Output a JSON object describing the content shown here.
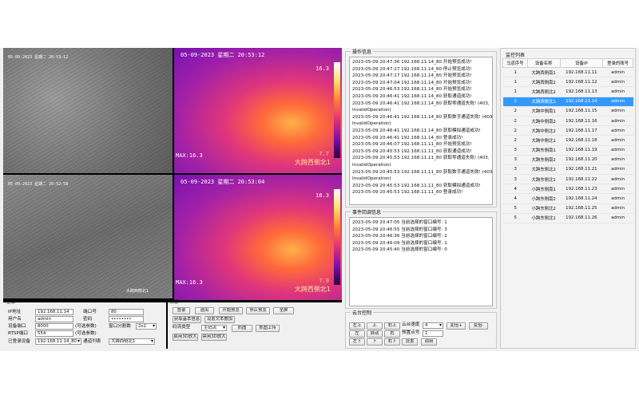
{
  "video": {
    "cam1_stamp": "05-09-2023 星期二 20:53:12",
    "cam2_stamp": "05-09-2023 星期二 20:52:58",
    "cam2_name": "大跨西侧北1",
    "thermal1": {
      "stamp": "05-09-2023 星期二 20:53:12",
      "top_val": "16.3",
      "max_label": "MAX:16.3",
      "min_val": "7.7",
      "name": "大跨西侧北1"
    },
    "thermal2": {
      "stamp": "05-09-2023 星期二 20:53:04",
      "top_val": "16.3",
      "max_label": "MAX:16.3",
      "min_val": "7.9",
      "name": "大跨西侧北1"
    }
  },
  "operation": {
    "title": "操作信息",
    "logs": [
      "2023-05-09 20:47:36 192.168.11.14_80 开始预览成功!",
      "2023-05-09 20:47:27 192.168.11.14_80 停止预览成功!",
      "2023-05-09 20:47:17 192.168.11.14_80 开始预览成功!",
      "2023-05-09 20:47:04 192.168.11.14_80 开始预览成功!",
      "2023-05-09 20:46:53 192.168.11.14_80 开始预览成功!",
      "2023-05-09 20:46:41 192.168.11.14_80 获取通道成功!",
      "2023-05-09 20:46:41 192.168.11.14_80 获取零通道失败! (403,",
      "InvalidOperation)",
      "2023-05-09 20:46:41 192.168.11.14_80 获取数字通道失败! (403,",
      "InvalidOperation)",
      "2023-05-09 20:46:41 192.168.11.14_80 获取模拟通道成功!",
      "2023-05-09 20:46:41 192.168.11.14_80 登录成功!",
      "2023-05-09 20:46:07 192.168.11.11_80 开始预览成功!",
      "2023-05-09 20:45:53 192.168.11.11_80 获取通道成功!",
      "2023-05-09 20:45:53 192.168.11.11_80 获取零通道失败! (403,",
      "InvalidOperation)",
      "2023-05-09 20:45:53 192.168.11.11_80 获取数字通道失败! (403,",
      "InvalidOperation)",
      "2023-05-09 20:45:53 192.168.11.11_80 获取模拟通道成功!",
      "2023-05-09 20:45:53 192.168.11.11_80 登录成功!"
    ]
  },
  "events": {
    "title": "事件回调信息",
    "logs": [
      "2023-05-09 20:47:05 当前选择的窗口编号: 1",
      "2023-05-09 20:46:55 当前选择的窗口编号: 3",
      "2023-05-09 20:46:36 当前选择的窗口编号: 2",
      "2023-05-09 20:46:09 当前选择的窗口编号: 1",
      "2023-05-09 20:45:40 当前选择的窗口编号: 0"
    ]
  },
  "login": {
    "title": "登录",
    "ip_label": "IP地址",
    "ip_value": "192.168.11.14",
    "port_label": "端口号",
    "port_value": "80",
    "user_label": "用户名",
    "user_value": "admin",
    "pwd_label": "密码",
    "pwd_value": "••••••••",
    "devport_label": "设备端口",
    "devport_value": "8000",
    "devport_hint": "(可选参数)",
    "split_label": "窗口分割数",
    "split_value": "2x2",
    "rtsp_label": "RTSP端口",
    "rtsp_value": "554",
    "rtsp_hint": "(可选参数)",
    "logged_label": "已登录设备",
    "logged_value": "192.168.11.14_80",
    "channel_label": "通道列表",
    "channel_value": "大跨西侧北1"
  },
  "preview": {
    "title": "预览",
    "btn_login": "登录",
    "btn_logout": "退出",
    "btn_start": "开始预览",
    "btn_stop": "停止预览",
    "btn_full": "全屏",
    "btn_getinfo": "获取基本信息",
    "btn_osd": "设置文本叠加",
    "stream_label": "码流类型",
    "stream_value": "主码流",
    "btn_capture": "抓图",
    "btn_capture_upload": "抓图上传",
    "btn_3d_on": "启用3D放大",
    "btn_3d_off": "禁用3D放大"
  },
  "ptz": {
    "title": "云台控制",
    "up_left": "左上",
    "up": "上",
    "up_right": "右上",
    "left": "左",
    "auto": "自动",
    "right": "右",
    "down_left": "左下",
    "down": "下",
    "down_right": "右下",
    "speed_label": "云台速度",
    "speed_value": "4",
    "preset_label": "预置点号",
    "preset_value": "1",
    "zoom_in": "变倍+",
    "zoom_out": "变倍-",
    "btn_set": "设置",
    "btn_call": "调用"
  },
  "device_list": {
    "title": "监控列表",
    "headers": [
      "马道序号",
      "设备名称",
      "设备IP",
      "登录的账号"
    ],
    "selected_index": 3,
    "rows": [
      [
        "1",
        "大跨西侧南1",
        "192.168.11.11",
        "admin"
      ],
      [
        "1",
        "大跨西侧南2",
        "192.168.11.12",
        "admin"
      ],
      [
        "1",
        "大跨西侧北2",
        "192.168.11.13",
        "admin"
      ],
      [
        "1",
        "大跨西侧北1",
        "192.168.11.14",
        "admin"
      ],
      [
        "2",
        "大跨中侧南1",
        "192.168.11.15",
        "admin"
      ],
      [
        "2",
        "大跨中侧南2",
        "192.168.11.16",
        "admin"
      ],
      [
        "2",
        "大跨中侧北2",
        "192.168.11.17",
        "admin"
      ],
      [
        "2",
        "大跨中侧北1",
        "192.168.11.18",
        "admin"
      ],
      [
        "3",
        "大跨东侧南1",
        "192.168.11.19",
        "admin"
      ],
      [
        "3",
        "大跨东侧南2",
        "192.168.11.20",
        "admin"
      ],
      [
        "3",
        "大跨东侧北2",
        "192.168.11.21",
        "admin"
      ],
      [
        "3",
        "大跨东侧北1",
        "192.168.11.22",
        "admin"
      ],
      [
        "4",
        "小跨东侧南1",
        "192.168.11.23",
        "admin"
      ],
      [
        "4",
        "小跨东侧南2",
        "192.168.11.24",
        "admin"
      ],
      [
        "5",
        "小跨东侧北2",
        "192.168.11.25",
        "admin"
      ],
      [
        "5",
        "小跨东侧北1",
        "192.168.11.26",
        "admin"
      ]
    ]
  }
}
